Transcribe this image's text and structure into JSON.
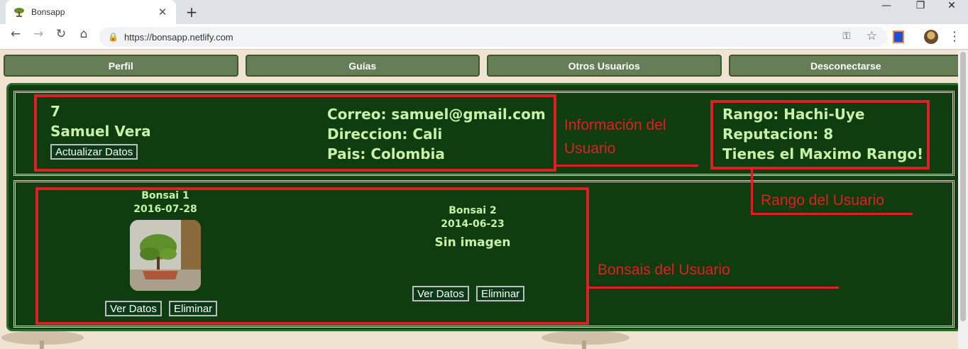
{
  "browser": {
    "tab_title": "Bonsapp",
    "tab_close": "✕",
    "new_tab": "+",
    "url": "https://bonsapp.netlify.com",
    "window_minimize": "—",
    "window_maximize": "❐",
    "window_close": "✕"
  },
  "nav": {
    "perfil": "Perfil",
    "guias": "Guías",
    "otros_usuarios": "Otros Usuarios",
    "desconectarse": "Desconectarse"
  },
  "user": {
    "id": "7",
    "name": "Samuel Vera",
    "update_button": "Actualizar Datos",
    "email": "Correo: samuel@gmail.com",
    "address": "Direccion: Cali",
    "country": "Pais: Colombia"
  },
  "rank": {
    "rango": "Rango: Hachi-Uye",
    "reputacion": "Reputacion: 8",
    "message": "Tienes el Maximo Rango!"
  },
  "bonsais": [
    {
      "name": "Bonsai 1",
      "date": "2016-07-28",
      "view_button": "Ver Datos",
      "delete_button": "Eliminar"
    },
    {
      "name": "Bonsai 2",
      "date": "2014-06-23",
      "no_image": "Sin imagen",
      "view_button": "Ver Datos",
      "delete_button": "Eliminar"
    }
  ],
  "annotations": {
    "user_info_line1": "Información del",
    "user_info_line2": "Usuario",
    "rank_label": "Rango del Usuario",
    "bonsais_label": "Bonsais del Usuario"
  },
  "colors": {
    "annotation_red": "#e01e25",
    "panel_green": "#0f3d0f",
    "nav_button": "#667e58",
    "text_green": "#c9f2a8"
  }
}
